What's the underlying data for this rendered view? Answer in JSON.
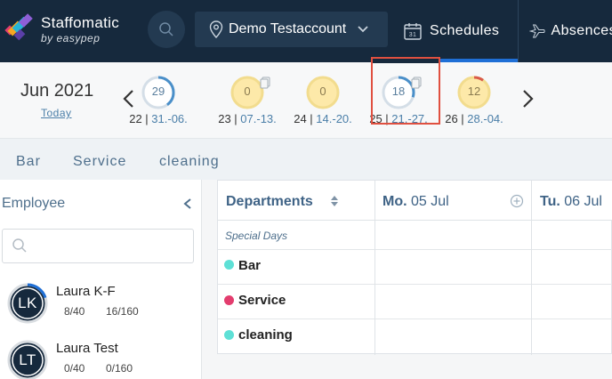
{
  "brand": {
    "name": "Staffomatic",
    "sub": "by easypep"
  },
  "header": {
    "account": "Demo Testaccount",
    "nav_schedules": "Schedules",
    "nav_absences": "Absences"
  },
  "calendar": {
    "month": "Jun 2021",
    "today": "Today",
    "weeks": [
      {
        "count": "29",
        "week": "22",
        "range": "31.-06.",
        "status": "blue",
        "progress": 0.4,
        "copy": false
      },
      {
        "count": "0",
        "week": "23",
        "range": "07.-13.",
        "status": "yellow",
        "progress": 0,
        "copy": true
      },
      {
        "count": "0",
        "week": "24",
        "range": "14.-20.",
        "status": "yellow",
        "progress": 0,
        "copy": false
      },
      {
        "count": "18",
        "week": "25",
        "range": "21.-27.",
        "status": "blue",
        "progress": 0.3,
        "copy": true
      },
      {
        "count": "12",
        "week": "26",
        "range": "28.-04.",
        "status": "yellow-red",
        "progress": 0.1,
        "copy": false
      }
    ]
  },
  "filters": [
    "Bar",
    "Service",
    "cleaning"
  ],
  "employees": {
    "title": "Employee",
    "search_placeholder": "",
    "list": [
      {
        "initials": "LK",
        "name": "Laura K-F",
        "week_hours": "8/40",
        "month_hours": "16/160",
        "progress": 0.2
      },
      {
        "initials": "LT",
        "name": "Laura Test",
        "week_hours": "0/40",
        "month_hours": "0/160",
        "progress": 0
      }
    ]
  },
  "schedule": {
    "departments_header": "Departments",
    "days": [
      {
        "dow": "Mo.",
        "date": "05 Jul"
      },
      {
        "dow": "Tu.",
        "date": "06 Jul"
      }
    ],
    "special_days": "Special Days",
    "departments": [
      {
        "name": "Bar",
        "color": "#5ee0d6"
      },
      {
        "name": "Service",
        "color": "#e33d6e"
      },
      {
        "name": "cleaning",
        "color": "#5ee0d6"
      }
    ]
  },
  "colors": {
    "topbar": "#16293d",
    "accent": "#1f6fd6",
    "link": "#4a7ea8",
    "ring_blue": "#cfdbe5",
    "ring_yellow": "#f6e7a1"
  }
}
